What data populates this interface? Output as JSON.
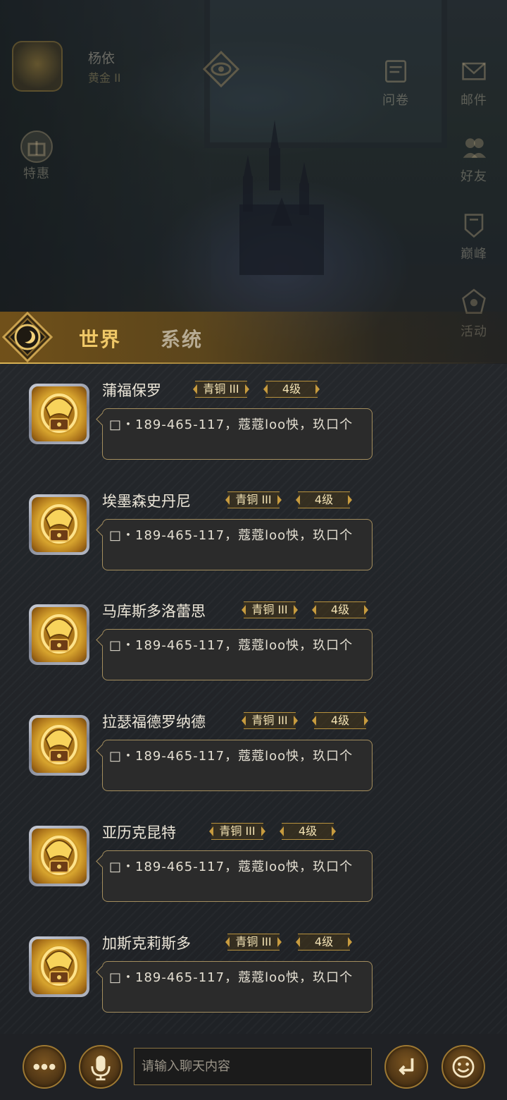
{
  "hud": {
    "profile": {
      "name": "杨依",
      "rank": "黄金 II"
    },
    "left_icons": [
      {
        "label": "特惠",
        "icon": "gift-icon"
      }
    ],
    "top_icons": [
      {
        "label": "问卷",
        "icon": "survey-icon"
      },
      {
        "label": "邮件",
        "icon": "mail-icon"
      }
    ],
    "right_icons": [
      {
        "label": "好友",
        "icon": "friends-icon"
      },
      {
        "label": "巅峰",
        "icon": "peak-icon"
      },
      {
        "label": "活动",
        "icon": "activity-icon"
      }
    ]
  },
  "chat": {
    "tabs": [
      {
        "label": "世界",
        "active": true
      },
      {
        "label": "系统",
        "active": false
      }
    ],
    "messages": [
      {
        "name": "蒲福保罗",
        "rank": "青铜 III",
        "level": "4级",
        "text": "□・189-465-117，蔻蔻loo怏，玖口个"
      },
      {
        "name": "埃墨森史丹尼",
        "rank": "青铜 III",
        "level": "4级",
        "text": "□・189-465-117，蔻蔻loo怏，玖口个"
      },
      {
        "name": "马库斯多洛蕾思",
        "rank": "青铜 III",
        "level": "4级",
        "text": "□・189-465-117，蔻蔻loo怏，玖口个"
      },
      {
        "name": "拉瑟福德罗纳德",
        "rank": "青铜 III",
        "level": "4级",
        "text": "□・189-465-117，蔻蔻loo怏，玖口个"
      },
      {
        "name": "亚历克昆特",
        "rank": "青铜 III",
        "level": "4级",
        "text": "□・189-465-117，蔻蔻loo怏，玖口个"
      },
      {
        "name": "加斯克莉斯多",
        "rank": "青铜 III",
        "level": "4级",
        "text": "□・189-465-117，蔻蔻loo怏，玖口个"
      }
    ]
  },
  "input_bar": {
    "placeholder": "请输入聊天内容",
    "value": "",
    "buttons": [
      "more-icon",
      "microphone-icon",
      "send-icon",
      "emoji-icon"
    ]
  },
  "colors": {
    "accent_gold": "#f0c867",
    "tab_inactive": "#b7ab93",
    "bubble_border": "#a48e5e",
    "panel_bg": "#24272b"
  }
}
